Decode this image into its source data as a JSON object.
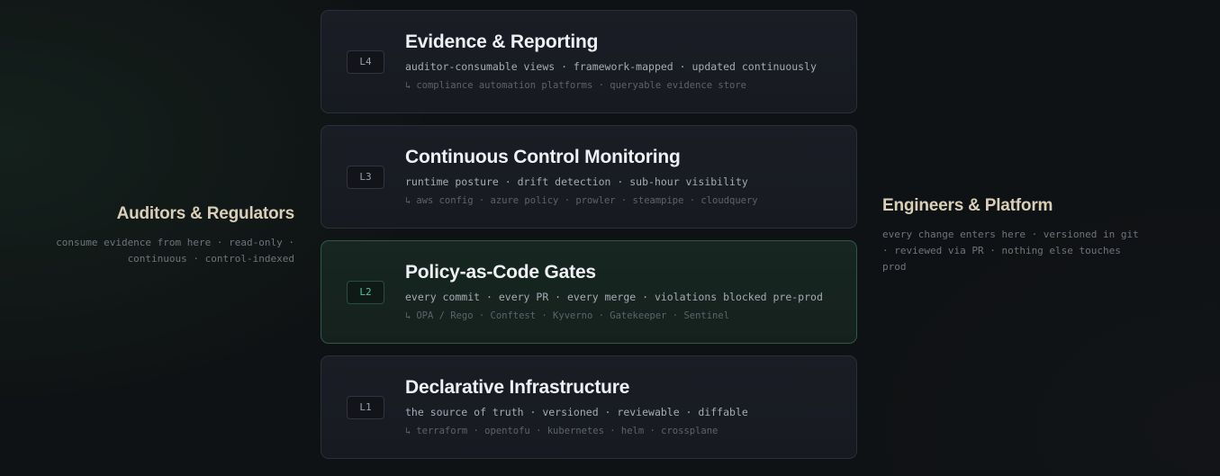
{
  "left_audience": {
    "title": "Auditors & Regulators",
    "line1": "consume evidence from here · read-only ·",
    "line2": "continuous · control-indexed"
  },
  "right_audience": {
    "title": "Engineers & Platform",
    "line1": "every change enters here · versioned in git",
    "line2": "· reviewed via PR · nothing else touches",
    "line3": "prod"
  },
  "layers": [
    {
      "badge": "L4",
      "title": "Evidence & Reporting",
      "description": "auditor-consumable views · framework-mapped · updated continuously",
      "tools_arrow": "↳",
      "tools": "compliance automation platforms · queryable evidence store",
      "highlighted": false
    },
    {
      "badge": "L3",
      "title": "Continuous Control Monitoring",
      "description": "runtime posture · drift detection · sub-hour visibility",
      "tools_arrow": "↳",
      "tools": "aws config · azure policy · prowler · steampipe · cloudquery",
      "highlighted": false
    },
    {
      "badge": "L2",
      "title": "Policy-as-Code Gates",
      "description": "every commit · every PR · every merge · violations blocked pre-prod",
      "tools_arrow": "↳",
      "tools": "OPA / Rego · Conftest · Kyverno · Gatekeeper · Sentinel",
      "highlighted": true
    },
    {
      "badge": "L1",
      "title": "Declarative Infrastructure",
      "description": "the source of truth · versioned · reviewable · diffable",
      "tools_arrow": "↳",
      "tools": "terraform · opentofu · kubernetes · helm · crossplane",
      "highlighted": false
    }
  ],
  "colors": {
    "background": "#0f1214",
    "card": "#1a1d25",
    "card_border": "#2a2f39",
    "highlight_card": "#172621",
    "highlight_border": "#2c5a44",
    "highlight_accent": "#4fc79b",
    "side_title": "#d9cfb8"
  }
}
